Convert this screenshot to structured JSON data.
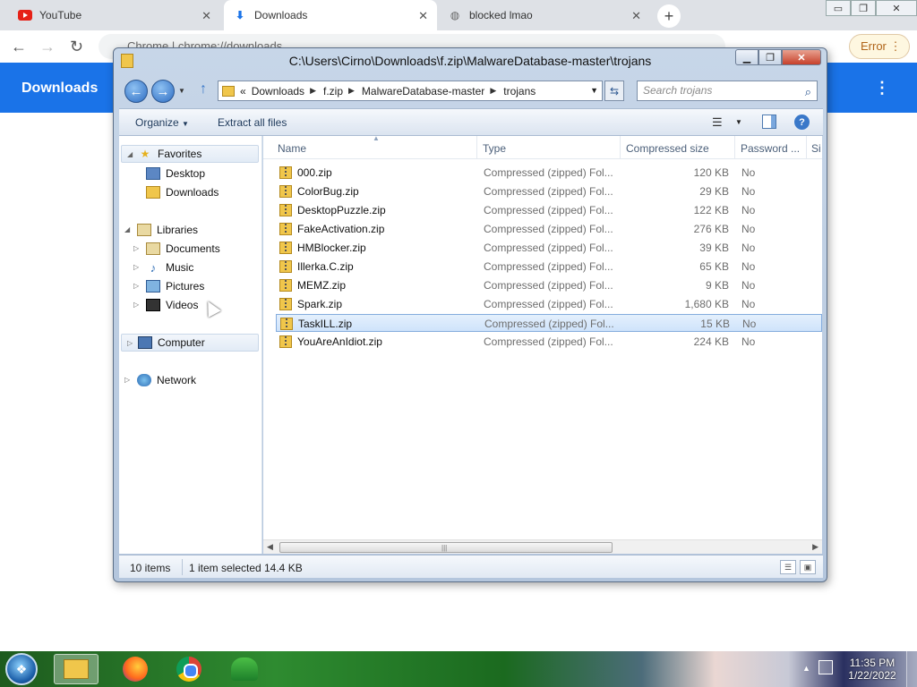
{
  "browser": {
    "tabs": [
      {
        "label": "YouTube",
        "active": false
      },
      {
        "label": "Downloads",
        "active": true
      },
      {
        "label": "blocked lmao",
        "active": false
      }
    ],
    "omnibox": "Chrome | chrome://downloads",
    "error_button": "Error",
    "downloads_title": "Downloads"
  },
  "explorer": {
    "title": "C:\\Users\\Cirno\\Downloads\\f.zip\\MalwareDatabase-master\\trojans",
    "address": {
      "overflow": "«",
      "crumbs": [
        "Downloads",
        "f.zip",
        "MalwareDatabase-master",
        "trojans"
      ]
    },
    "search_placeholder": "Search trojans",
    "commands": {
      "organize": "Organize",
      "extract_all": "Extract all files"
    },
    "nav": {
      "favorites": "Favorites",
      "desktop": "Desktop",
      "downloads": "Downloads",
      "libraries": "Libraries",
      "documents": "Documents",
      "music": "Music",
      "pictures": "Pictures",
      "videos": "Videos",
      "computer": "Computer",
      "network": "Network"
    },
    "columns": {
      "name": "Name",
      "type": "Type",
      "size": "Compressed size",
      "password": "Password ...",
      "extra": "Si"
    },
    "files": [
      {
        "name": "000.zip",
        "type": "Compressed (zipped) Fol...",
        "size": "120 KB",
        "password": "No"
      },
      {
        "name": "ColorBug.zip",
        "type": "Compressed (zipped) Fol...",
        "size": "29 KB",
        "password": "No"
      },
      {
        "name": "DesktopPuzzle.zip",
        "type": "Compressed (zipped) Fol...",
        "size": "122 KB",
        "password": "No"
      },
      {
        "name": "FakeActivation.zip",
        "type": "Compressed (zipped) Fol...",
        "size": "276 KB",
        "password": "No"
      },
      {
        "name": "HMBlocker.zip",
        "type": "Compressed (zipped) Fol...",
        "size": "39 KB",
        "password": "No"
      },
      {
        "name": "Illerka.C.zip",
        "type": "Compressed (zipped) Fol...",
        "size": "65 KB",
        "password": "No"
      },
      {
        "name": "MEMZ.zip",
        "type": "Compressed (zipped) Fol...",
        "size": "9 KB",
        "password": "No"
      },
      {
        "name": "Spark.zip",
        "type": "Compressed (zipped) Fol...",
        "size": "1,680 KB",
        "password": "No"
      },
      {
        "name": "TaskILL.zip",
        "type": "Compressed (zipped) Fol...",
        "size": "15 KB",
        "password": "No",
        "selected": true
      },
      {
        "name": "YouAreAnIdiot.zip",
        "type": "Compressed (zipped) Fol...",
        "size": "224 KB",
        "password": "No"
      }
    ],
    "status": {
      "count": "10 items",
      "selected": "1 item selected",
      "size": "14.4 KB"
    }
  },
  "taskbar": {
    "time": "11:35 PM",
    "date": "1/22/2022"
  }
}
